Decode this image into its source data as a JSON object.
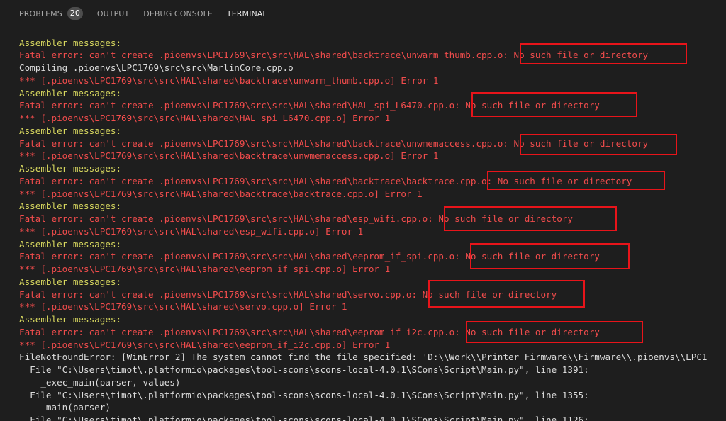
{
  "tabs": {
    "problems": "PROBLEMS",
    "problems_count": "20",
    "output": "OUTPUT",
    "debug_console": "DEBUG CONSOLE",
    "terminal": "TERMINAL"
  },
  "colors": {
    "background": "#1e1e1e",
    "assembler_text": "#d7d75f",
    "error_text": "#f14c4c",
    "plain_text": "#dcdcdc",
    "highlight_box": "#e8141a"
  },
  "terminal_lines": [
    {
      "kind": "warn",
      "text": "Assembler messages:"
    },
    {
      "kind": "err",
      "text": "Fatal error: can't create .pioenvs\\LPC1769\\src\\src\\HAL\\shared\\backtrace\\unwarm_thumb.cpp.o: No such file or directory"
    },
    {
      "kind": "plain",
      "text": "Compiling .pioenvs\\LPC1769\\src\\src\\MarlinCore.cpp.o"
    },
    {
      "kind": "err",
      "text": "*** [.pioenvs\\LPC1769\\src\\src\\HAL\\shared\\backtrace\\unwarm_thumb.cpp.o] Error 1"
    },
    {
      "kind": "warn",
      "text": "Assembler messages:"
    },
    {
      "kind": "err",
      "text": "Fatal error: can't create .pioenvs\\LPC1769\\src\\src\\HAL\\shared\\HAL_spi_L6470.cpp.o: No such file or directory"
    },
    {
      "kind": "err",
      "text": "*** [.pioenvs\\LPC1769\\src\\src\\HAL\\shared\\HAL_spi_L6470.cpp.o] Error 1"
    },
    {
      "kind": "warn",
      "text": "Assembler messages:"
    },
    {
      "kind": "err",
      "text": "Fatal error: can't create .pioenvs\\LPC1769\\src\\src\\HAL\\shared\\backtrace\\unwmemaccess.cpp.o: No such file or directory"
    },
    {
      "kind": "err",
      "text": "*** [.pioenvs\\LPC1769\\src\\src\\HAL\\shared\\backtrace\\unwmemaccess.cpp.o] Error 1"
    },
    {
      "kind": "warn",
      "text": "Assembler messages:"
    },
    {
      "kind": "err",
      "text": "Fatal error: can't create .pioenvs\\LPC1769\\src\\src\\HAL\\shared\\backtrace\\backtrace.cpp.o: No such file or directory"
    },
    {
      "kind": "err",
      "text": "*** [.pioenvs\\LPC1769\\src\\src\\HAL\\shared\\backtrace\\backtrace.cpp.o] Error 1"
    },
    {
      "kind": "warn",
      "text": "Assembler messages:"
    },
    {
      "kind": "err",
      "text": "Fatal error: can't create .pioenvs\\LPC1769\\src\\src\\HAL\\shared\\esp_wifi.cpp.o: No such file or directory"
    },
    {
      "kind": "err",
      "text": "*** [.pioenvs\\LPC1769\\src\\src\\HAL\\shared\\esp_wifi.cpp.o] Error 1"
    },
    {
      "kind": "warn",
      "text": "Assembler messages:"
    },
    {
      "kind": "err",
      "text": "Fatal error: can't create .pioenvs\\LPC1769\\src\\src\\HAL\\shared\\eeprom_if_spi.cpp.o: No such file or directory"
    },
    {
      "kind": "err",
      "text": "*** [.pioenvs\\LPC1769\\src\\src\\HAL\\shared\\eeprom_if_spi.cpp.o] Error 1"
    },
    {
      "kind": "warn",
      "text": "Assembler messages:"
    },
    {
      "kind": "err",
      "text": "Fatal error: can't create .pioenvs\\LPC1769\\src\\src\\HAL\\shared\\servo.cpp.o: No such file or directory"
    },
    {
      "kind": "err",
      "text": "*** [.pioenvs\\LPC1769\\src\\src\\HAL\\shared\\servo.cpp.o] Error 1"
    },
    {
      "kind": "warn",
      "text": "Assembler messages:"
    },
    {
      "kind": "err",
      "text": "Fatal error: can't create .pioenvs\\LPC1769\\src\\src\\HAL\\shared\\eeprom_if_i2c.cpp.o: No such file or directory"
    },
    {
      "kind": "err",
      "text": "*** [.pioenvs\\LPC1769\\src\\src\\HAL\\shared\\eeprom_if_i2c.cpp.o] Error 1"
    },
    {
      "kind": "plain",
      "text": "FileNotFoundError: [WinError 2] The system cannot find the file specified: 'D:\\\\Work\\\\Printer Firmware\\\\Firmware\\\\.pioenvs\\\\LPC1"
    },
    {
      "kind": "plain",
      "text": "  File \"C:\\Users\\timot\\.platformio\\packages\\tool-scons\\scons-local-4.0.1\\SCons\\Script\\Main.py\", line 1391:"
    },
    {
      "kind": "plain",
      "text": "    _exec_main(parser, values)"
    },
    {
      "kind": "plain",
      "text": "  File \"C:\\Users\\timot\\.platformio\\packages\\tool-scons\\scons-local-4.0.1\\SCons\\Script\\Main.py\", line 1355:"
    },
    {
      "kind": "plain",
      "text": "    _main(parser)"
    },
    {
      "kind": "plain",
      "text": "  File \"C:\\Users\\timot\\.platformio\\packages\\tool-scons\\scons-local-4.0.1\\SCons\\Script\\Main.py\", line 1126:"
    }
  ]
}
